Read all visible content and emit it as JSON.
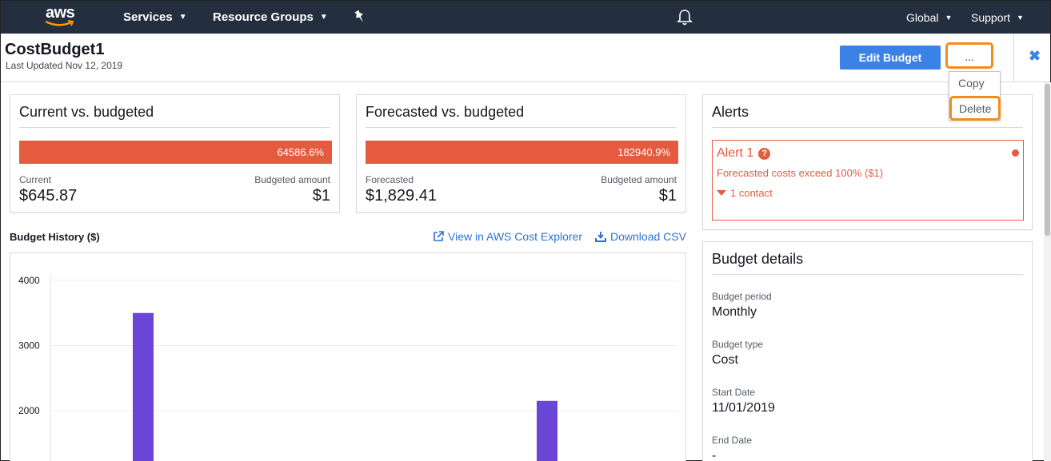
{
  "nav": {
    "logo": "aws",
    "services": "Services",
    "resource_groups": "Resource Groups",
    "region": "Global",
    "support": "Support"
  },
  "header": {
    "title": "CostBudget1",
    "subtitle": "Last Updated Nov 12, 2019",
    "edit_label": "Edit Budget",
    "more_label": "...",
    "menu": {
      "copy": "Copy",
      "delete": "Delete"
    }
  },
  "current_card": {
    "title": "Current vs. budgeted",
    "percent": "64586.6%",
    "left_label": "Current",
    "left_value": "$645.87",
    "right_label": "Budgeted amount",
    "right_value": "$1"
  },
  "forecast_card": {
    "title": "Forecasted vs. budgeted",
    "percent": "182940.9%",
    "left_label": "Forecasted",
    "left_value": "$1,829.41",
    "right_label": "Budgeted amount",
    "right_value": "$1"
  },
  "history": {
    "title": "Budget History ($)",
    "view_link": "View in AWS Cost Explorer",
    "download_link": "Download CSV"
  },
  "chart_data": {
    "type": "bar",
    "categories": [
      "",
      ""
    ],
    "values": [
      3500,
      2150
    ],
    "yticks": [
      2000,
      3000,
      4000
    ],
    "ylim": [
      1800,
      4150
    ],
    "color": "#6b46d6",
    "grid": true
  },
  "alerts": {
    "title": "Alerts",
    "alert_name": "Alert 1",
    "help": "?",
    "message": "Forecasted costs exceed 100% ($1)",
    "contact": "1 contact",
    "color": "#e55b3f"
  },
  "details": {
    "title": "Budget details",
    "items": [
      {
        "label": "Budget period",
        "value": "Monthly"
      },
      {
        "label": "Budget type",
        "value": "Cost"
      },
      {
        "label": "Start Date",
        "value": "11/01/2019"
      },
      {
        "label": "End Date",
        "value": "-"
      }
    ]
  }
}
